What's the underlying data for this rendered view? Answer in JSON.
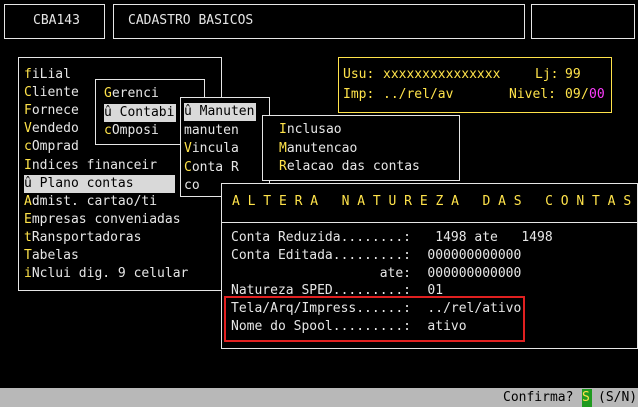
{
  "header": {
    "code": "CBA143",
    "title": "CADASTRO BASICOS"
  },
  "menu1": {
    "items": [
      {
        "hot": "f",
        "rest": "iLial",
        "pre": ""
      },
      {
        "hot": "C",
        "rest": "liente",
        "pre": ""
      },
      {
        "hot": "F",
        "rest": "ornece",
        "pre": ""
      },
      {
        "hot": "V",
        "rest": "endedo",
        "pre": ""
      },
      {
        "hot": "c",
        "rest": "Omprad",
        "pre": ""
      },
      {
        "hot": "I",
        "rest": "ndices financeir",
        "pre": ""
      },
      {
        "hot": "",
        "rest": "û Plano contas",
        "pre": ""
      },
      {
        "hot": "A",
        "rest": "dmist. cartao/ti",
        "pre": ""
      },
      {
        "hot": "E",
        "rest": "mpresas conveniadas",
        "pre": ""
      },
      {
        "hot": "t",
        "rest": "Ransportadoras",
        "pre": ""
      },
      {
        "hot": "T",
        "rest": "abelas",
        "pre": ""
      },
      {
        "hot": "i",
        "rest": "Nclui dig. 9 celular",
        "pre": ""
      }
    ]
  },
  "menu2": {
    "items": [
      {
        "hot": "G",
        "rest": "erenci"
      },
      {
        "hot": "",
        "rest": "û Contabi"
      },
      {
        "hot": "c",
        "rest": "Omposi"
      }
    ]
  },
  "menu3": {
    "items": [
      {
        "hot": "",
        "rest": "û Manuten"
      },
      {
        "hot": "",
        "rest": "manuten"
      },
      {
        "hot": "V",
        "rest": "incula"
      },
      {
        "hot": "C",
        "rest": "onta R"
      },
      {
        "hot": "",
        "rest": "co"
      }
    ]
  },
  "menu4": {
    "items": [
      {
        "hot": "I",
        "rest": "nclusao"
      },
      {
        "hot": "M",
        "rest": "anutencao"
      },
      {
        "hot": "R",
        "rest": "elacao das contas"
      }
    ]
  },
  "userinfo": {
    "usu_label": "Usu:",
    "usu_value": "xxxxxxxxxxxxxxx",
    "lj_label": "Lj:",
    "lj_value": "99",
    "imp_label": "Imp:",
    "imp_value": "../rel/av",
    "nivel_label": "Nivel:",
    "nivel_a": "09",
    "nivel_sep": "/",
    "nivel_b": "00"
  },
  "dialog": {
    "title": "A L T E R A   N A T U R E Z A   D A S   C O N T A S",
    "rows": [
      {
        "label": "Conta Reduzida........:",
        "value": "  1498 ate   1498"
      },
      {
        "label": "Conta Editada.........:",
        "value": " 000000000000"
      },
      {
        "label": "                   ate:",
        "value": " 000000000000"
      },
      {
        "label": "Natureza SPED.........:",
        "value": " 01"
      },
      {
        "label": "Tela/Arq/Impress......:",
        "value": " ../rel/ativo"
      },
      {
        "label": "Nome do Spool.........:",
        "value": " ativo"
      }
    ]
  },
  "statusbar": {
    "prompt": "Confirma?",
    "answer": "S",
    "options": "(S/N)"
  },
  "colors": {
    "highlight": "#e02020",
    "hotkey": "#ffe34a",
    "answer_bg": "#1f9a1f",
    "magenta": "#ff3dff"
  }
}
